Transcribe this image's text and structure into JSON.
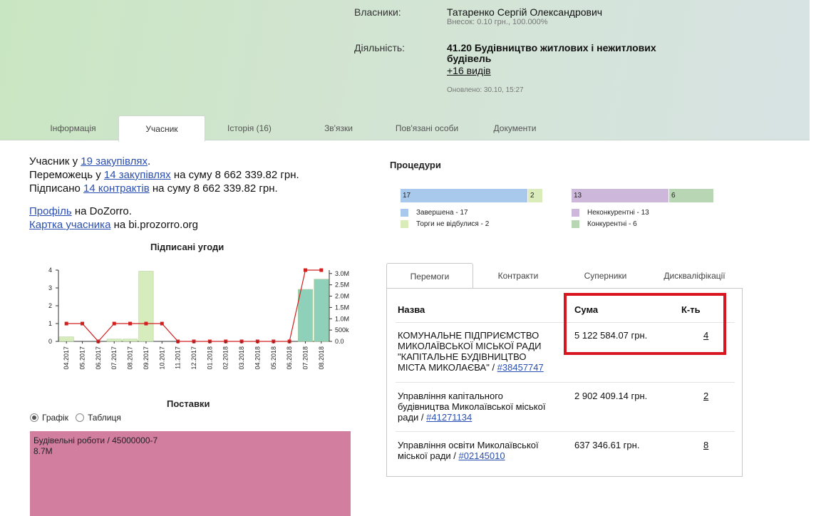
{
  "header": {
    "owners_label": "Власники:",
    "owner_name": "Татаренко Сергій Олександрович",
    "owner_share": "Внесок: 0.10 грн., 100.000%",
    "activity_label": "Діяльність:",
    "activity_line1": "41.20 Будівництво житлових і нежитлових",
    "activity_line2": "будівель",
    "activity_more": "+16 видів",
    "updated": "Оновлено: 30.10, 15:27"
  },
  "tabs": [
    "Інформація",
    "Учасник",
    "Історія (16)",
    "Зв'язки",
    "Пов'язані особи",
    "Документи"
  ],
  "summary": {
    "l1_pre": "Учасник у ",
    "l1_link": "19 закупівлях",
    "l1_post": ".",
    "l2_pre": "Переможець у ",
    "l2_link": "14 закупівлях",
    "l2_post": " на суму 8 662 339.82 грн.",
    "l3_pre": "Підписано ",
    "l3_link": "14 контрактів",
    "l3_post": " на суму 8 662 339.82 грн.",
    "l4_link": "Профіль",
    "l4_post": " на DoZorro.",
    "l5_link": "Картка учасника",
    "l5_post": " на bi.prozorro.org"
  },
  "chart_data": {
    "type": "bar",
    "title": "Підписані угоди",
    "categories": [
      "04.2017",
      "05.2017",
      "06.2017",
      "07.2017",
      "08.2017",
      "09.2017",
      "10.2017",
      "11.2017",
      "12.2017",
      "01.2018",
      "02.2018",
      "03.2018",
      "04.2018",
      "05.2018",
      "06.2018",
      "07.2018",
      "08.2018"
    ],
    "series": [
      {
        "values": [
          0.2,
          0,
          0,
          0.1,
          0.1,
          3.1,
          0,
          0,
          0,
          0,
          0,
          0,
          0,
          0,
          0,
          2.3,
          2.75
        ],
        "axis": "right",
        "unit": "M"
      },
      {
        "values": [
          1,
          1,
          0,
          1,
          1,
          1,
          1,
          0,
          0,
          0,
          0,
          0,
          0,
          0,
          0,
          4,
          4
        ],
        "axis": "left",
        "type": "line"
      }
    ],
    "left_ticks": [
      "0",
      "1",
      "2",
      "3",
      "4"
    ],
    "right_ticks": [
      "0.0",
      "500k",
      "1.0M",
      "1.5M",
      "2.0M",
      "2.5M",
      "3.0M"
    ],
    "ylim_left": [
      0,
      4
    ],
    "ylim_right": [
      0,
      3.15
    ],
    "bar_colors": [
      "#d6ecbd",
      "#d6ecbd",
      "#d6ecbd",
      "#d6ecbd",
      "#d6ecbd",
      "#d6ecbd",
      "#d6ecbd",
      "#d6ecbd",
      "#d6ecbd",
      "#d6ecbd",
      "#d6ecbd",
      "#d6ecbd",
      "#d6ecbd",
      "#d6ecbd",
      "#d6ecbd",
      "#8fd0bb",
      "#8fd0bb"
    ],
    "line_color": "#d22020"
  },
  "supplies": {
    "title": "Поставки",
    "radio_graph": "Графік",
    "radio_table": "Таблиця",
    "tile_label": "Будівельні роботи / 45000000-7",
    "tile_value": "8.7M"
  },
  "procedures": {
    "title": "Процедури",
    "bar1": [
      {
        "label": "17",
        "value": 17,
        "color": "#a8c8ec"
      },
      {
        "label": "2",
        "value": 2,
        "color": "#d9ecb9"
      }
    ],
    "bar2": [
      {
        "label": "13",
        "value": 13,
        "color": "#cdb8dc"
      },
      {
        "label": "6",
        "value": 6,
        "color": "#b9d6b4"
      }
    ],
    "legend1": [
      {
        "label": "Завершена - 17",
        "color": "#a8c8ec"
      },
      {
        "label": "Торги не відбулися - 2",
        "color": "#d9ecb9"
      }
    ],
    "legend2": [
      {
        "label": "Неконкурентні - 13",
        "color": "#cdb8dc"
      },
      {
        "label": "Конкурентні - 6",
        "color": "#b9d6b4"
      }
    ]
  },
  "panel_tabs": [
    "Перемоги",
    "Контракти",
    "Суперники",
    "Дискваліфікації"
  ],
  "wins": {
    "col_name": "Назва",
    "col_sum": "Сума",
    "col_count": "К-ть",
    "rows": [
      {
        "name_lines": [
          "КОМУНАЛЬНЕ ПІДПРИЄМСТВО",
          "МИКОЛАЇВСЬКОЇ МІСЬКОЇ РАДИ",
          "\"КАПІТАЛЬНЕ БУДІВНИЦТВО"
        ],
        "name_last": "МІСТА МИКОЛАЄВА\" / ",
        "code": "#38457747",
        "sum": "5 122 584.07 грн.",
        "count": "4"
      },
      {
        "name_lines": [
          "Управління капітального",
          "будівництва Миколаївської міської"
        ],
        "name_last": "ради / ",
        "code": "#41271134",
        "sum": "2 902 409.14 грн.",
        "count": "2"
      },
      {
        "name_lines": [
          "Управління освіти Миколаївської"
        ],
        "name_last": "міської ради / ",
        "code": "#02145010",
        "sum": "637 346.61 грн.",
        "count": "8"
      }
    ]
  }
}
